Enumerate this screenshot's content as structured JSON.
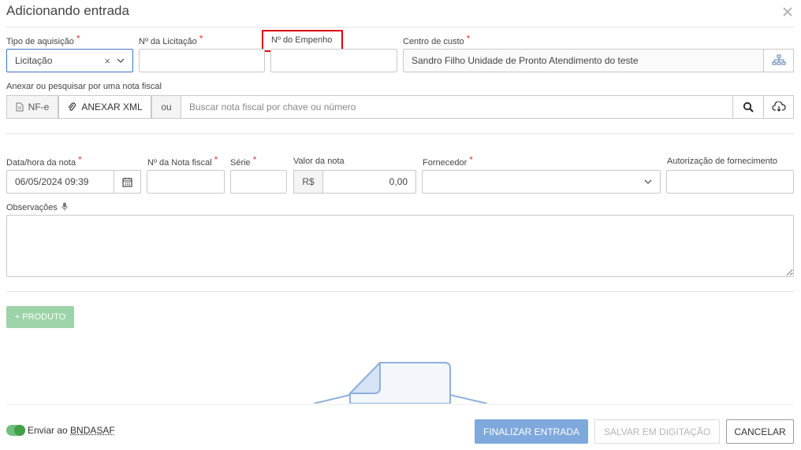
{
  "dialog": {
    "title": "Adicionando entrada",
    "close_icon": "close-icon"
  },
  "row1": {
    "tipo_aquisicao": {
      "label": "Tipo de aquisição",
      "required": "*",
      "value": "Licitação",
      "clear": "×"
    },
    "num_licitacao": {
      "label": "Nº da Licitação",
      "required": "*",
      "value": ""
    },
    "num_empenho": {
      "label": "Nº do Empenho",
      "value": ""
    },
    "centro_custo": {
      "label": "Centro de custo",
      "required": "*",
      "value": "Sandro Filho Unidade de Pronto Atendimento do teste",
      "icon": "sitemap-icon"
    }
  },
  "anexar": {
    "label": "Anexar ou pesquisar por uma nota fiscal",
    "nfe_label": "NF-e",
    "anexar_xml_label": "ANEXAR XML",
    "ou_label": "ou",
    "search_placeholder": "Buscar nota fiscal por chave ou número",
    "search_icon": "search-icon",
    "download_icon": "cloud-download-icon"
  },
  "row2": {
    "data_hora": {
      "label": "Data/hora da nota",
      "required": "*",
      "value": "06/05/2024 09:39"
    },
    "num_nota": {
      "label": "Nº da Nota fiscal",
      "required": "*",
      "value": ""
    },
    "serie": {
      "label": "Série",
      "required": "*",
      "value": ""
    },
    "valor": {
      "label": "Valor da nota",
      "currency": "R$",
      "value": "0,00"
    },
    "fornecedor": {
      "label": "Fornecedor",
      "required": "*",
      "value": ""
    },
    "autorizacao": {
      "label": "Autorização de fornecimento",
      "value": ""
    }
  },
  "observacoes": {
    "label": "Observações",
    "value": ""
  },
  "produto_button": "+ PRODUTO",
  "footer": {
    "toggle_prefix": "Enviar ao ",
    "toggle_suffix": "BNDASAF",
    "finalizar": "FINALIZAR ENTRADA",
    "salvar": "SALVAR EM DIGITAÇÃO",
    "cancelar": "CANCELAR"
  },
  "colors": {
    "accent": "#3b75c3",
    "primary_button": "#7fa8dc",
    "produto_button": "#9dd3a8",
    "required": "#e53935",
    "highlight": "#e3000f"
  }
}
